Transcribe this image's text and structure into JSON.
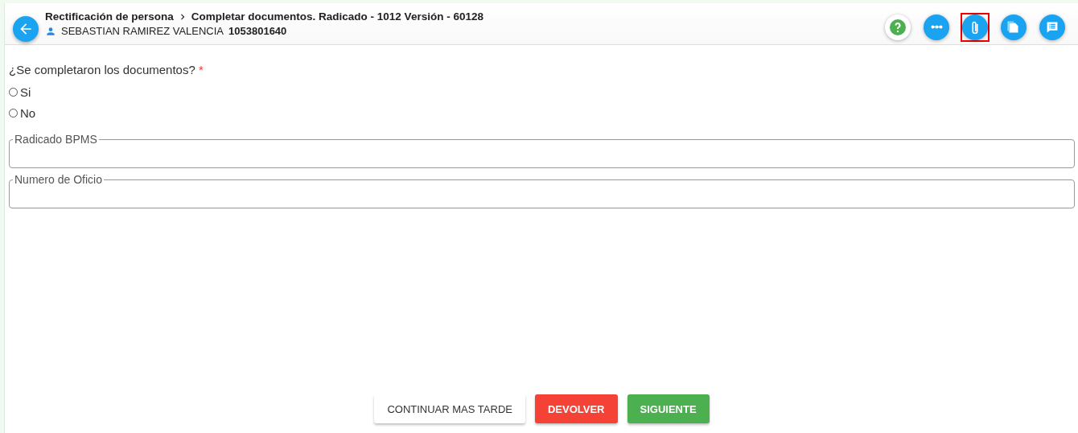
{
  "header": {
    "breadcrumb": [
      "Rectificación de persona",
      "Completar documentos. Radicado - 1012 Versión - 60128"
    ],
    "person_name": "SEBASTIAN RAMIREZ VALENCIA",
    "person_id": "1053801640"
  },
  "tools": [
    {
      "kind": "help",
      "highlighted": false
    },
    {
      "kind": "more",
      "highlighted": false
    },
    {
      "kind": "attach",
      "highlighted": true
    },
    {
      "kind": "copy",
      "highlighted": false
    },
    {
      "kind": "notes",
      "highlighted": false
    }
  ],
  "question": {
    "label": "¿Se completaron los documentos?",
    "required_mark": "*",
    "options": [
      {
        "label": "Si",
        "selected": false
      },
      {
        "label": "No",
        "selected": false
      }
    ]
  },
  "fields": [
    {
      "label": "Radicado BPMS"
    },
    {
      "label": "Numero de Oficio"
    }
  ],
  "buttons": [
    {
      "label": "CONTINUAR MAS TARDE",
      "kind": "default"
    },
    {
      "label": "DEVOLVER",
      "kind": "danger"
    },
    {
      "label": "SIGUIENTE",
      "kind": "success"
    }
  ]
}
